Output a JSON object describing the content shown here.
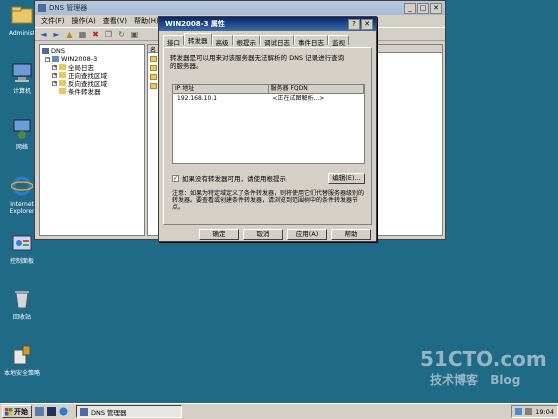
{
  "desktop": {
    "icons": [
      {
        "name": "administrator-folder",
        "label": "Administ"
      },
      {
        "name": "my-computer",
        "label": "计算机"
      },
      {
        "name": "network",
        "label": "网络"
      },
      {
        "name": "internet-explorer",
        "label": "Internet Explorer"
      },
      {
        "name": "control-panel",
        "label": "控制面板"
      },
      {
        "name": "recycle-bin",
        "label": "回收站"
      },
      {
        "name": "local-security-policy",
        "label": "本地安全策略"
      }
    ],
    "watermark": {
      "line1": "51CTO.com",
      "line2": "技术博客",
      "line3": "Blog"
    }
  },
  "dns_window": {
    "title": "DNS 管理器",
    "menu": [
      "文件(F)",
      "操作(A)",
      "查看(V)",
      "帮助(H)"
    ],
    "tree": [
      {
        "label": "DNS",
        "level": 0
      },
      {
        "label": "WIN2008-3",
        "level": 1
      },
      {
        "label": "全局日志",
        "level": 2
      },
      {
        "label": "正向查找区域",
        "level": 2
      },
      {
        "label": "反向查找区域",
        "level": 2
      },
      {
        "label": "条件转发器",
        "level": 2
      }
    ],
    "right_header": "名"
  },
  "dialog": {
    "title": "WIN2008-3 属性",
    "tabs": [
      "接口",
      "转发器",
      "高级",
      "根提示",
      "调试日志",
      "事件日志",
      "监视"
    ],
    "active_tab": "转发器",
    "description": "转发器是可以用来对该服务器无法解析的 DNS 记录进行查询的服务器。",
    "table_headers": [
      "IP 地址",
      "服务器 FQDN"
    ],
    "table_rows": [
      {
        "ip": "192.168.10.1",
        "fqdn": "<正在试图解析...>"
      }
    ],
    "checkbox_label": "如果没有转发器可用，请使用根提示",
    "checkbox_checked": true,
    "edit_button": "编辑(E)...",
    "note": "注意：如果为特定域定义了条件转发器，则将使用它们代替服务器级别的转发器。要查看或创建条件转发器，请浏览到范围树中的条件转发器节点。",
    "buttons": [
      "确定",
      "取消",
      "应用(A)",
      "帮助"
    ]
  },
  "taskbar": {
    "start_label": "开始",
    "task_label": "DNS 管理器",
    "clock": "19:04"
  },
  "colors": {
    "desktop": "#1f6a86",
    "dialog_title": "#0a246a"
  }
}
